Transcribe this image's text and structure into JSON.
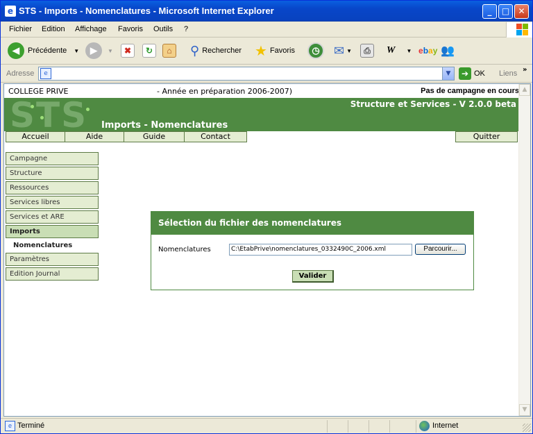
{
  "window": {
    "title": "STS - Imports - Nomenclatures - Microsoft Internet Explorer",
    "icon": "ie-icon",
    "buttons": {
      "minimize": "_",
      "maximize": "□",
      "close": "✕"
    }
  },
  "menubar": {
    "items": [
      "Fichier",
      "Edition",
      "Affichage",
      "Favoris",
      "Outils",
      "?"
    ]
  },
  "toolbar": {
    "back_label": "Précédente",
    "search_label": "Rechercher",
    "favorites_label": "Favoris"
  },
  "addressbar": {
    "label": "Adresse",
    "url": "",
    "go_label": "OK",
    "links_label": "Liens"
  },
  "page": {
    "header": {
      "college": "COLLEGE PRIVE",
      "annee": "- Année en préparation 2006-2007)",
      "campagne": "Pas de campagne en cours"
    },
    "banner": {
      "logo": "STS",
      "app_name": "Structure et Services - V 2.0.0 beta",
      "page_title": "Imports - Nomenclatures"
    },
    "nav": {
      "accueil": "Accueil",
      "aide": "Aide",
      "guide": "Guide",
      "contact": "Contact",
      "quitter": "Quitter"
    },
    "sidebar": {
      "items": [
        "Campagne",
        "Structure",
        "Ressources",
        "Services libres",
        "Services et ARE",
        "Imports",
        "Paramètres",
        "Edition Journal"
      ],
      "active": "Imports",
      "sub_item": "Nomenclatures"
    },
    "panel": {
      "title": "Sélection du fichier des nomenclatures",
      "field_label": "Nomenclatures",
      "file_value": "C:\\EtabPrive\\nomenclatures_0332490C_2006.xml",
      "browse_label": "Parcourir...",
      "submit_label": "Valider"
    }
  },
  "statusbar": {
    "text": "Terminé",
    "zone": "Internet"
  }
}
